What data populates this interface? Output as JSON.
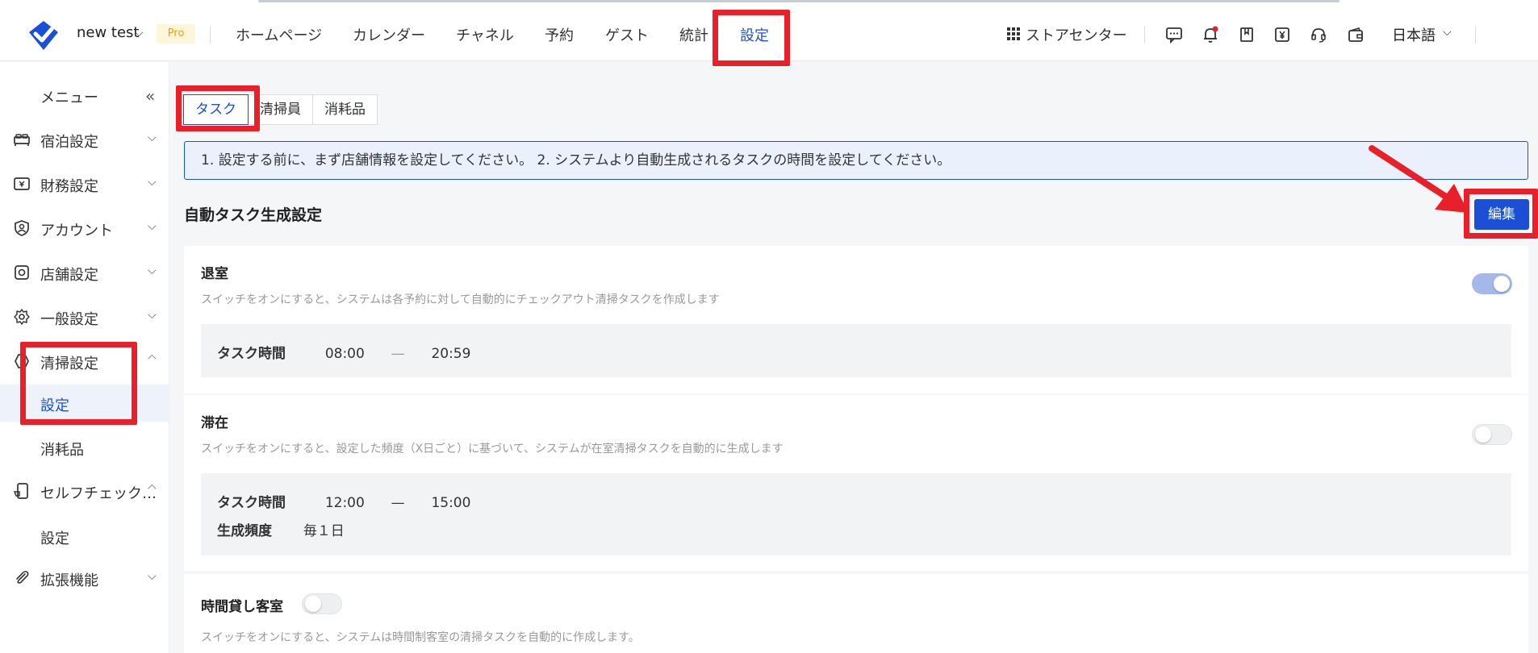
{
  "header": {
    "store_name": "new test",
    "pro_badge": "Pro",
    "nav": [
      "ホームページ",
      "カレンダー",
      "チャネル",
      "予約",
      "ゲスト",
      "統計",
      "設定"
    ],
    "active_nav": "設定",
    "store_center": "ストアセンター",
    "language": "日本語",
    "icons": [
      "message-icon",
      "bell-icon",
      "bookmark-icon",
      "yen-icon",
      "headset-icon",
      "wallet-icon"
    ]
  },
  "sidebar": {
    "menu_title": "メニュー",
    "items": [
      {
        "label": "宿泊設定",
        "icon": "bed-icon"
      },
      {
        "label": "財務設定",
        "icon": "finance-icon"
      },
      {
        "label": "アカウント",
        "icon": "account-icon"
      },
      {
        "label": "店舗設定",
        "icon": "store-icon"
      },
      {
        "label": "一般設定",
        "icon": "gear-icon"
      },
      {
        "label": "清掃設定",
        "icon": "cleaning-icon"
      },
      {
        "label": "セルフチェック…",
        "icon": "self-checkin-icon"
      },
      {
        "label": "拡張機能",
        "icon": "paperclip-icon"
      }
    ],
    "cleaning_sub": [
      "設定",
      "消耗品"
    ],
    "selfcheck_sub": [
      "設定"
    ]
  },
  "main": {
    "tabs": [
      "タスク",
      "清掃員",
      "消耗品"
    ],
    "notice": "1. 設定する前に、まず店舗情報を設定してください。 2. システムより自動生成されるタスクの時間を設定してください。",
    "section_title": "自動タスク生成設定",
    "edit_label": "編集",
    "checkout": {
      "title": "退室",
      "desc": "スイッチをオンにすると、システムは各予約に対して自動的にチェックアウト清掃タスクを作成します",
      "enabled": true,
      "time_label": "タスク時間",
      "start": "08:00",
      "dash": "—",
      "end": "20:59"
    },
    "stay": {
      "title": "滞在",
      "desc": "スイッチをオンにすると、設定した頻度（X日ごと）に基づいて、システムが在室清掃タスクを自動的に生成します",
      "enabled": false,
      "time_label": "タスク時間",
      "start": "12:00",
      "dash": "—",
      "end": "15:00",
      "freq_label": "生成頻度",
      "freq_value": "毎１日"
    },
    "hourly": {
      "title": "時間貸し客室",
      "desc": "スイッチをオンにすると、システムは時間制客室の清掃タスクを自動的に作成します。",
      "enabled": false
    }
  },
  "colors": {
    "accent": "#1a4fd6",
    "annotation": "#e8202a"
  }
}
